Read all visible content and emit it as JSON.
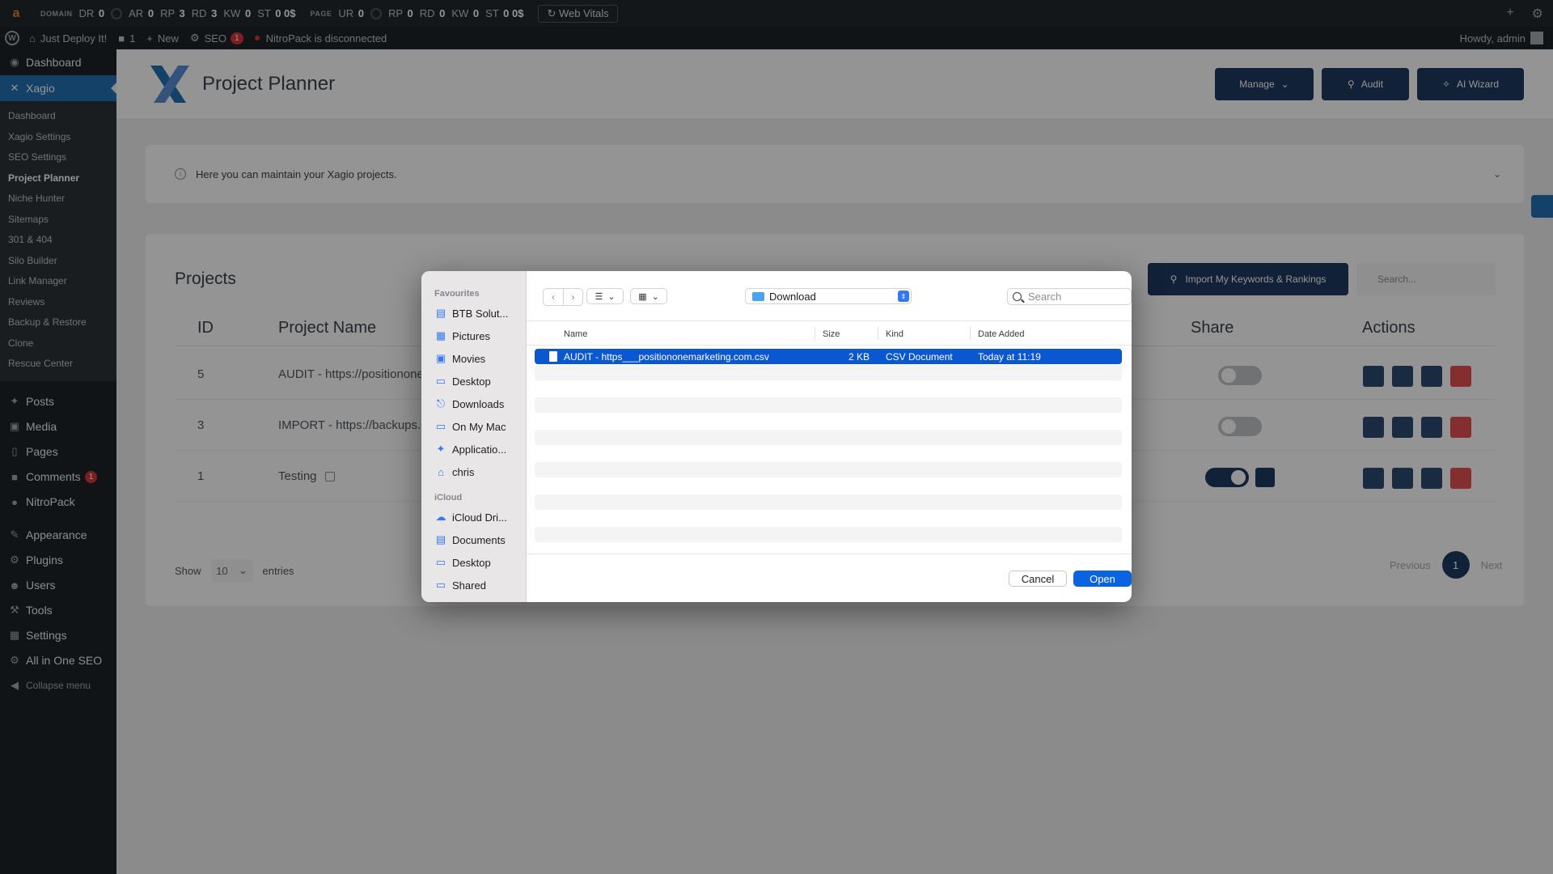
{
  "seo_bar": {
    "domain_label": "DOMAIN",
    "domain_metrics": [
      {
        "k": "DR",
        "v": "0"
      },
      {
        "k": "AR",
        "v": "0"
      },
      {
        "k": "RP",
        "v": "3"
      },
      {
        "k": "RD",
        "v": "3"
      },
      {
        "k": "KW",
        "v": "0"
      },
      {
        "k": "ST",
        "v": "0 0$"
      }
    ],
    "page_label": "PAGE",
    "page_metrics": [
      {
        "k": "UR",
        "v": "0"
      },
      {
        "k": "RP",
        "v": "0"
      },
      {
        "k": "RD",
        "v": "0"
      },
      {
        "k": "KW",
        "v": "0"
      },
      {
        "k": "ST",
        "v": "0 0$"
      }
    ],
    "web_vitals": "Web Vitals"
  },
  "admin_bar": {
    "site_name": "Just Deploy It!",
    "comments_count": "1",
    "new_label": "New",
    "seo_label": "SEO",
    "seo_badge": "1",
    "nitropack_status": "NitroPack is disconnected",
    "howdy": "Howdy, admin"
  },
  "sidebar": {
    "dashboard": "Dashboard",
    "xagio": "Xagio",
    "xagio_sub": [
      "Dashboard",
      "Xagio Settings",
      "SEO Settings",
      "Project Planner",
      "Niche Hunter",
      "Sitemaps",
      "301 & 404",
      "Silo Builder",
      "Link Manager",
      "Reviews",
      "Backup & Restore",
      "Clone",
      "Rescue Center"
    ],
    "posts": "Posts",
    "media": "Media",
    "pages": "Pages",
    "comments": "Comments",
    "comments_badge": "1",
    "nitropack": "NitroPack",
    "appearance": "Appearance",
    "plugins": "Plugins",
    "users": "Users",
    "tools": "Tools",
    "settings": "Settings",
    "aioseo": "All in One SEO",
    "collapse": "Collapse menu"
  },
  "header": {
    "title": "Project Planner",
    "manage": "Manage",
    "audit": "Audit",
    "ai_wizard": "AI Wizard"
  },
  "notice": {
    "text": "Here you can maintain your Xagio projects."
  },
  "projects": {
    "title": "Projects",
    "import_btn": "Import My Keywords & Rankings",
    "search_placeholder": "Search...",
    "columns": {
      "id": "ID",
      "name": "Project Name",
      "share": "Share",
      "actions": "Actions"
    },
    "rows": [
      {
        "id": "5",
        "name": "AUDIT - https://positionone",
        "shared": false
      },
      {
        "id": "3",
        "name": "IMPORT - https://backups.0",
        "shared": false
      },
      {
        "id": "1",
        "name": "Testing",
        "shared": true
      }
    ],
    "show": "Show",
    "entries_value": "10",
    "entries": "entries",
    "previous": "Previous",
    "page": "1",
    "next": "Next"
  },
  "dialog": {
    "favourites_label": "Favourites",
    "favourites": [
      {
        "label": "BTB Solut...",
        "icon": "document-icon"
      },
      {
        "label": "Pictures",
        "icon": "photo-icon"
      },
      {
        "label": "Movies",
        "icon": "film-icon"
      },
      {
        "label": "Desktop",
        "icon": "desktop-icon"
      },
      {
        "label": "Downloads",
        "icon": "download-icon"
      },
      {
        "label": "On My Mac",
        "icon": "folder-icon"
      },
      {
        "label": "Applicatio...",
        "icon": "apps-icon"
      },
      {
        "label": "chris",
        "icon": "home-icon"
      }
    ],
    "icloud_label": "iCloud",
    "icloud": [
      {
        "label": "iCloud Dri...",
        "icon": "cloud-icon"
      },
      {
        "label": "Documents",
        "icon": "document-icon"
      },
      {
        "label": "Desktop",
        "icon": "desktop-icon"
      },
      {
        "label": "Shared",
        "icon": "shared-folder-icon"
      }
    ],
    "location": "Download",
    "search_placeholder": "Search",
    "columns": {
      "name": "Name",
      "size": "Size",
      "kind": "Kind",
      "date": "Date Added"
    },
    "files": [
      {
        "name": "AUDIT  - https___positiononemarketing.com.csv",
        "size": "2 KB",
        "kind": "CSV Document",
        "date": "Today at 11:19"
      }
    ],
    "cancel": "Cancel",
    "open": "Open"
  }
}
